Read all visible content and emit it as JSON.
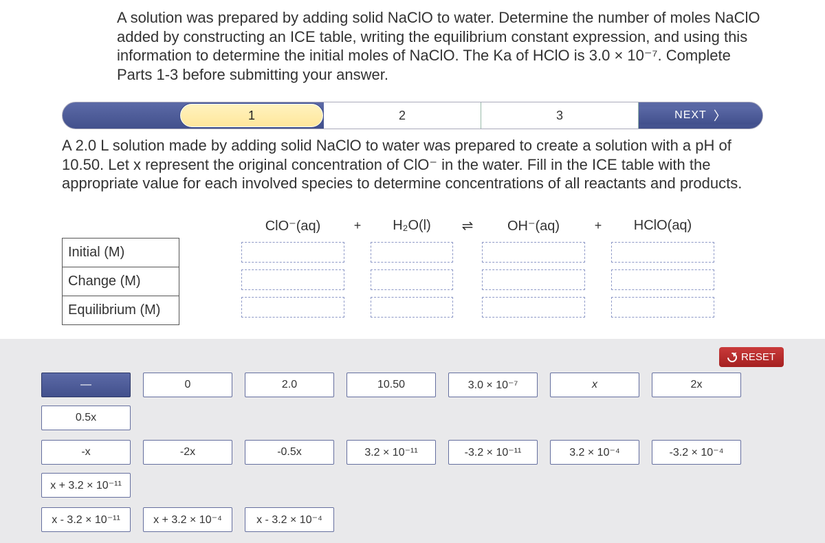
{
  "prompt": "A solution was prepared by adding solid NaClO to water. Determine the number of moles NaClO added by constructing an ICE table, writing the equilibrium constant expression, and using this information to determine the initial moles of NaClO. The Ka of HClO is 3.0 × 10⁻⁷. Complete Parts 1-3 before submitting your answer.",
  "stepper": {
    "step1": "1",
    "step2": "2",
    "step3": "3",
    "next": "NEXT"
  },
  "subprompt": "A 2.0 L solution made by adding solid NaClO to water was prepared to create a solution with a pH of 10.50. Let x represent the original concentration of ClO⁻ in the water. Fill in the ICE table with the appropriate value for each involved species to determine concentrations of all reactants and products.",
  "ice": {
    "rowlabels": {
      "initial": "Initial (M)",
      "change": "Change (M)",
      "equilibrium": "Equilibrium (M)"
    },
    "species": {
      "clo": "ClO⁻(aq)",
      "h2o": "H₂O(l)",
      "oh": "OH⁻(aq)",
      "hclo": "HClO(aq)"
    },
    "ops": {
      "plus": "+",
      "eq": "⇌"
    }
  },
  "reset": "RESET",
  "tiles": {
    "blank": "—",
    "zero": "0",
    "two": "2.0",
    "tenfifty": "10.50",
    "threeE7": "3.0 × 10⁻⁷",
    "x": "x",
    "twox": "2x",
    "halfx": "0.5x",
    "negx": "-x",
    "neg2x": "-2x",
    "neghalfx": "-0.5x",
    "p32E11": "3.2 × 10⁻¹¹",
    "n32E11": "-3.2 × 10⁻¹¹",
    "p32E4": "3.2 × 10⁻⁴",
    "n32E4": "-3.2 × 10⁻⁴",
    "xplus32E11": "x + 3.2 × 10⁻¹¹",
    "xminus32E11": "x - 3.2 × 10⁻¹¹",
    "xplus32E4": "x + 3.2 × 10⁻⁴",
    "xminus32E4": "x - 3.2 × 10⁻⁴"
  }
}
